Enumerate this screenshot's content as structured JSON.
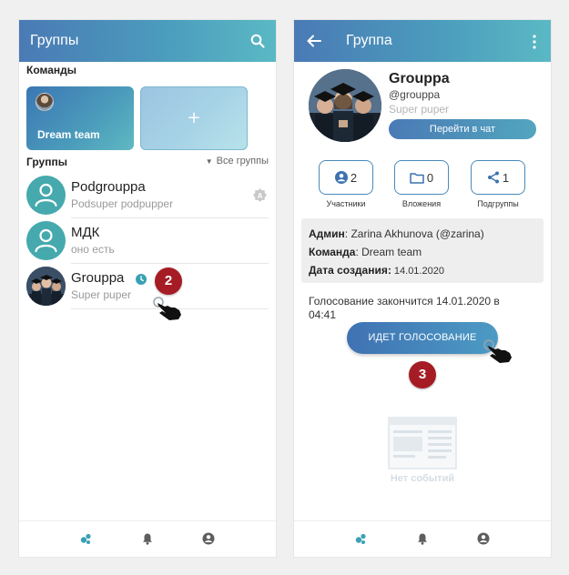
{
  "left_screen": {
    "app_bar": {
      "title": "Группы",
      "search_icon": "search-icon"
    },
    "teams_label": "Команды",
    "team_cards": [
      {
        "label": "Dream team"
      },
      {
        "label": "+"
      }
    ],
    "groups_label": "Группы",
    "all_groups_label": "Все группы",
    "groups": [
      {
        "name": "Podgrouppa",
        "subtitle": "Podsuper podpupper"
      },
      {
        "name": "МДК",
        "subtitle": "оно есть"
      },
      {
        "name": "Grouppa",
        "subtitle": "Super puper"
      }
    ],
    "step_badge": "2"
  },
  "right_screen": {
    "app_bar": {
      "title": "Группа",
      "back_icon": "arrow-back-icon",
      "menu_icon": "more-vertical-icon"
    },
    "group": {
      "title": "Grouppa",
      "handle": "@grouppa",
      "description": "Super puper",
      "chat_button": "Перейти в чат"
    },
    "stats": [
      {
        "value": "2",
        "label": "Участники",
        "icon": "person-icon"
      },
      {
        "value": "0",
        "label": "Вложения",
        "icon": "folder-icon"
      },
      {
        "value": "1",
        "label": "Подгруппы",
        "icon": "share-icon"
      }
    ],
    "info": {
      "admin_label": "Админ",
      "admin_value": ": Zarina Akhunova (@zarina)",
      "team_label": "Команда",
      "team_value": ": Dream team",
      "created_label": "Дата создания:",
      "created_value": " 14.01.2020"
    },
    "vote_text": "Голосование закончится 14.01.2020 в 04:41",
    "vote_button": "ИДЕТ ГОЛОСОВАНИЕ",
    "step_badge": "3",
    "empty_state": "Нет событий"
  },
  "colors": {
    "app_bar_start": "#4a7ab5",
    "app_bar_end": "#5ab9c4",
    "teal_avatar": "#45a9ae",
    "step_badge": "#a61c25"
  }
}
